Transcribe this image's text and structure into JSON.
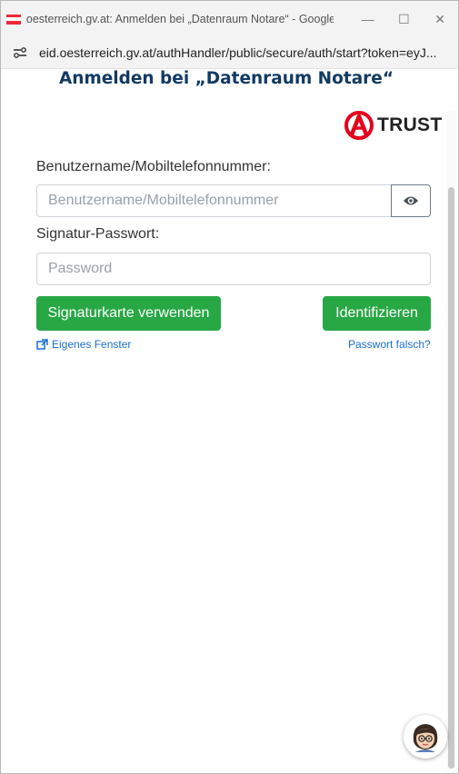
{
  "window": {
    "title": "oesterreich.gv.at: Anmelden bei „Datenraum Notare“ - Google...",
    "minimize_icon": "minimize-icon",
    "maximize_icon": "maximize-icon",
    "close_icon": "close-icon"
  },
  "urlbar": {
    "url": "eid.oesterreich.gv.at/authHandler/public/secure/auth/start?token=eyJ...",
    "site_icon": "site-settings-icon"
  },
  "page": {
    "heading": "Anmelden bei „Datenraum Notare“",
    "logo_text": "TRUST",
    "username_label": "Benutzername/Mobiltelefonnummer:",
    "username_placeholder": "Benutzername/Mobiltelefonnummer",
    "username_value": "",
    "password_label": "Signatur-Passwort:",
    "password_placeholder": "Password",
    "password_value": "",
    "signature_card_button": "Signaturkarte verwenden",
    "identify_button": "Identifizieren",
    "own_window_link": "Eigenes Fenster",
    "wrong_password_link": "Passwort falsch?",
    "eye_icon": "eye-icon",
    "external_link_icon": "external-link-icon",
    "chat_avatar": "chat-assistant-avatar"
  },
  "colors": {
    "accent_green": "#28a745",
    "heading_blue": "#123a63",
    "link_blue": "#1a6fd1",
    "atrust_red": "#e3001b",
    "austria_red": "#ed2939"
  }
}
